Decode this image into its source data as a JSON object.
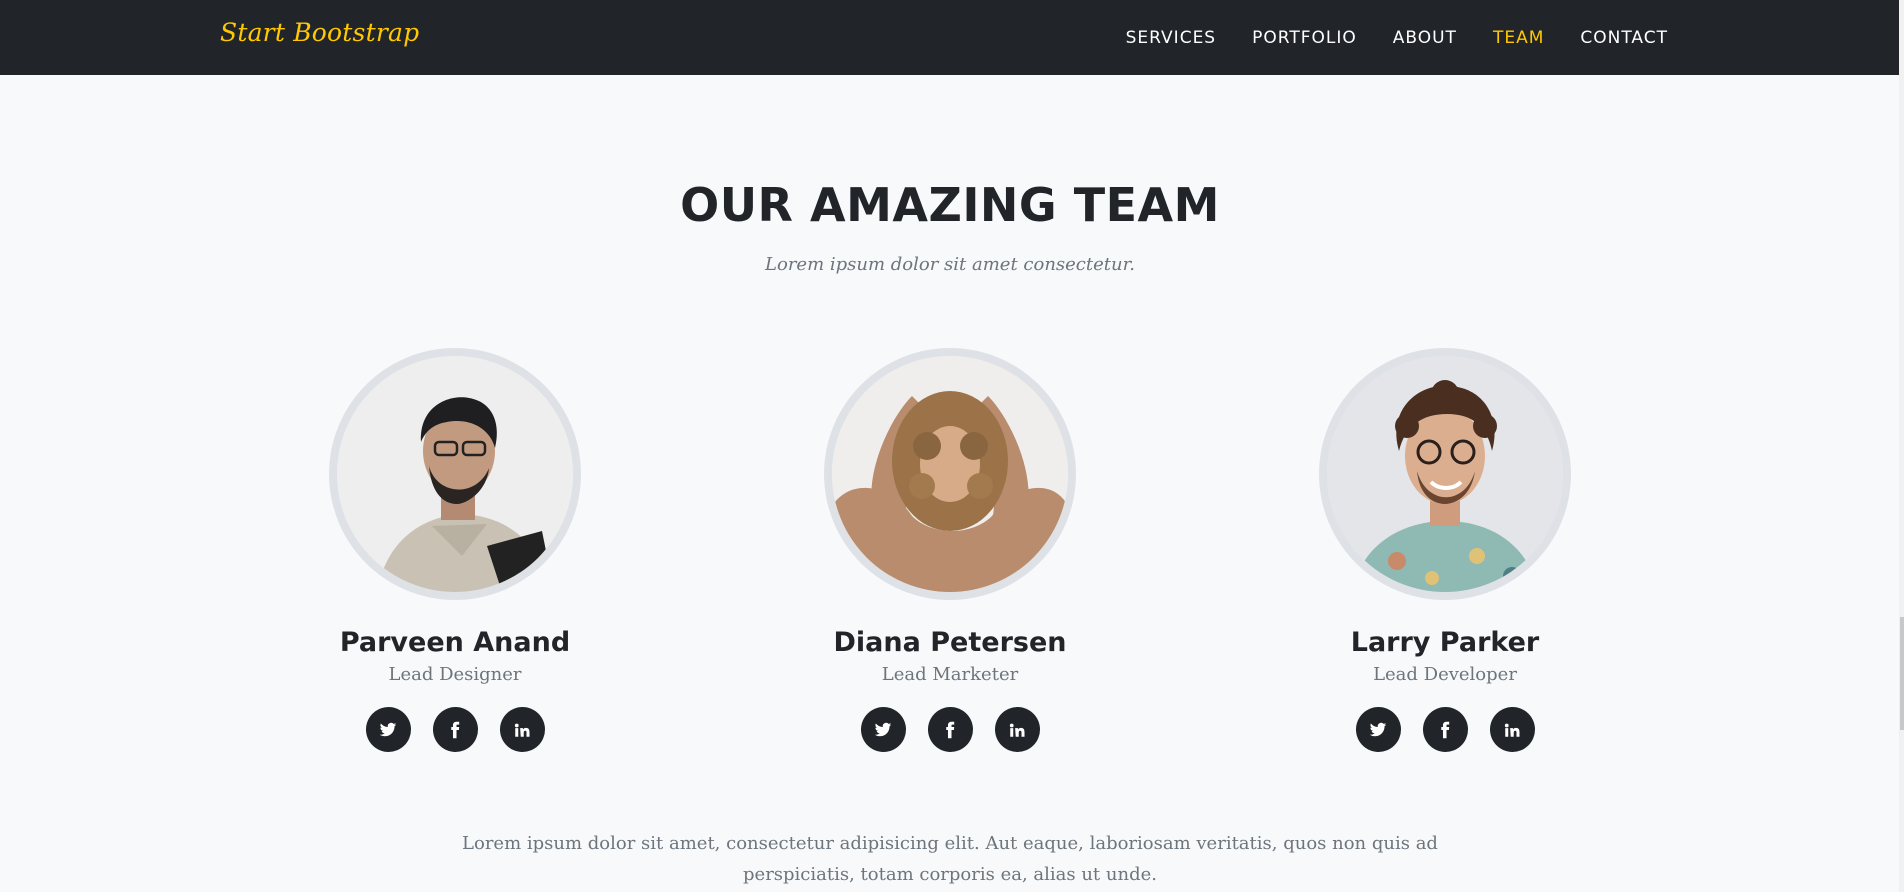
{
  "navbar": {
    "brand": "Start Bootstrap",
    "links": [
      {
        "label": "SERVICES",
        "active": false
      },
      {
        "label": "PORTFOLIO",
        "active": false
      },
      {
        "label": "ABOUT",
        "active": false
      },
      {
        "label": "TEAM",
        "active": true
      },
      {
        "label": "CONTACT",
        "active": false
      }
    ]
  },
  "team": {
    "heading": "OUR AMAZING TEAM",
    "subheading": "Lorem ipsum dolor sit amet consectetur.",
    "members": [
      {
        "name": "Parveen Anand",
        "role": "Lead Designer"
      },
      {
        "name": "Diana Petersen",
        "role": "Lead Marketer"
      },
      {
        "name": "Larry Parker",
        "role": "Lead Developer"
      }
    ],
    "social_icons": [
      "twitter-icon",
      "facebook-icon",
      "linkedin-icon"
    ],
    "footer_text": "Lorem ipsum dolor sit amet, consectetur adipisicing elit. Aut eaque, laboriosam veritatis, quos non quis ad perspiciatis, totam corporis ea, alias ut unde."
  },
  "colors": {
    "accent": "#ffc800",
    "dark": "#212529",
    "muted": "#6c757d",
    "background": "#f8f9fa"
  }
}
